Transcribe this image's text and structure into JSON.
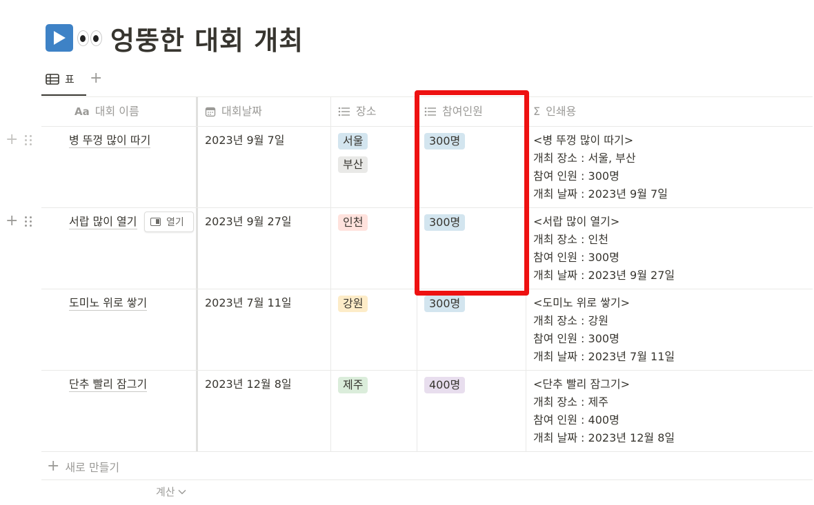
{
  "page": {
    "title": "엉뚱한 대회 개최",
    "icons": [
      "play-button-icon",
      "eyes-icon"
    ]
  },
  "views": {
    "active_tab": "표",
    "add_label": "+"
  },
  "table": {
    "columns": [
      {
        "icon": "Aa",
        "icon_name": "title-property-icon",
        "label": "대회 이름"
      },
      {
        "icon": "calendar",
        "icon_name": "calendar-icon",
        "label": "대회날짜"
      },
      {
        "icon": "list",
        "icon_name": "list-icon",
        "label": "장소"
      },
      {
        "icon": "list",
        "icon_name": "list-icon",
        "label": "참여인원"
      },
      {
        "icon": "Σ",
        "icon_name": "sigma-icon",
        "label": "인쇄용"
      }
    ],
    "rows": [
      {
        "name": "병 뚜껑 많이 따기",
        "date": "2023년 9월 7일",
        "places": [
          "서울",
          "부산"
        ],
        "people": "300명",
        "print": [
          "<병 뚜껑 많이 따기>",
          "개최 장소 : 서울, 부산",
          "참여 인원 : 300명",
          "개최 날짜 : 2023년 9월 7일"
        ]
      },
      {
        "name": "서랍 많이 열기",
        "date": "2023년 9월 27일",
        "places": [
          "인천"
        ],
        "people": "300명",
        "print": [
          "<서랍 많이 열기>",
          "개최 장소 : 인천",
          "참여 인원 : 300명",
          "개최 날짜 : 2023년 9월 27일"
        ]
      },
      {
        "name": "도미노 위로 쌓기",
        "date": "2023년 7월 11일",
        "places": [
          "강원"
        ],
        "people": "300명",
        "print": [
          "<도미노 위로 쌓기>",
          "개최 장소 : 강원",
          "참여 인원 : 300명",
          "개최 날짜 : 2023년 7월 11일"
        ]
      },
      {
        "name": "단추 빨리 잠그기",
        "date": "2023년 12월 8일",
        "places": [
          "제주"
        ],
        "people": "400명",
        "print": [
          "<단추 빨리 잠그기>",
          "개최 장소 : 제주",
          "참여 인원 : 400명",
          "개최 날짜 : 2023년 12월 8일"
        ]
      }
    ],
    "open_button_label": "열기",
    "new_row_label": "새로 만들기",
    "calc_label": "계산"
  },
  "colors": {
    "tag_blue": "#d3e5ef",
    "tag_gray": "#e9e9e7",
    "tag_red": "#ffe2dd",
    "tag_yellow": "#fdecc8",
    "tag_green": "#dbeddb",
    "tag_purple": "#e8deee",
    "highlight": "#ee1111"
  }
}
